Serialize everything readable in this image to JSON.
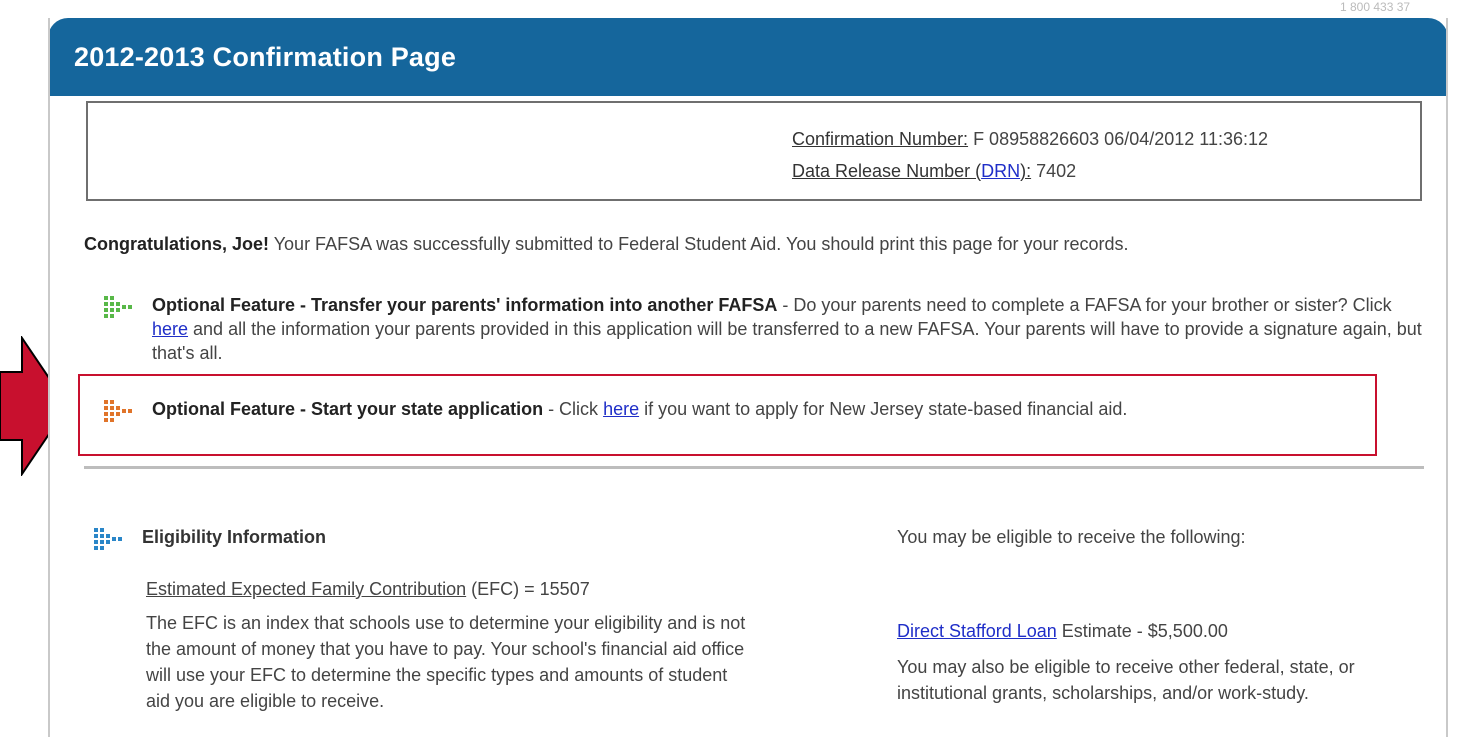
{
  "page": {
    "title": "2012-2013 Confirmation Page",
    "corner_text": "1 800 433 37"
  },
  "confirmation": {
    "number_label": "Confirmation Number:",
    "number_value": " F 08958826603 06/04/2012 11:36:12",
    "drn_label_prefix": "Data Release Number (",
    "drn_link": "DRN",
    "drn_label_suffix": "):",
    "drn_value": " 7402"
  },
  "congrats": {
    "bold": "Congratulations, Joe!",
    "text": " Your FAFSA was successfully submitted to Federal Student Aid. You should print this page for your records."
  },
  "features": [
    {
      "icon": "green-grid-arrow-icon",
      "title": "Optional Feature - Transfer your parents' information into another FAFSA",
      "before_link": " - Do your parents need to complete a FAFSA for your brother or sister? Click ",
      "link": "here",
      "after_link": " and all the information your parents provided in this application will be transferred to a new FAFSA. Your parents will have to provide a signature again, but that's all."
    },
    {
      "icon": "orange-grid-arrow-icon",
      "title": "Optional Feature - Start your state application",
      "before_link": " - Click ",
      "link": "here",
      "after_link": " if you want to apply for New Jersey state-based financial aid."
    }
  ],
  "eligibility": {
    "icon": "blue-grid-arrow-icon",
    "title": "Eligibility Information",
    "efc_label_a": "Estimated",
    "efc_label_b": " Expected Family Contribution",
    "efc_value": " (EFC) = 15507",
    "efc_description": "The EFC is an index that schools use to determine your eligibility and is not the amount of money that you have to pay. Your school's financial aid office will use your EFC to determine the specific types and amounts of student aid you are eligible to receive."
  },
  "aid": {
    "intro": "You may be eligible to receive the following:",
    "loan_link": "Direct Stafford Loan",
    "loan_text": " Estimate - $5,500.00",
    "also_text": "You may also be eligible to receive other federal, state, or institutional grants, scholarships, and/or work-study."
  },
  "colors": {
    "header_blue": "#15669c",
    "highlight_red": "#c8102e",
    "link_blue": "#1f2ec8"
  }
}
